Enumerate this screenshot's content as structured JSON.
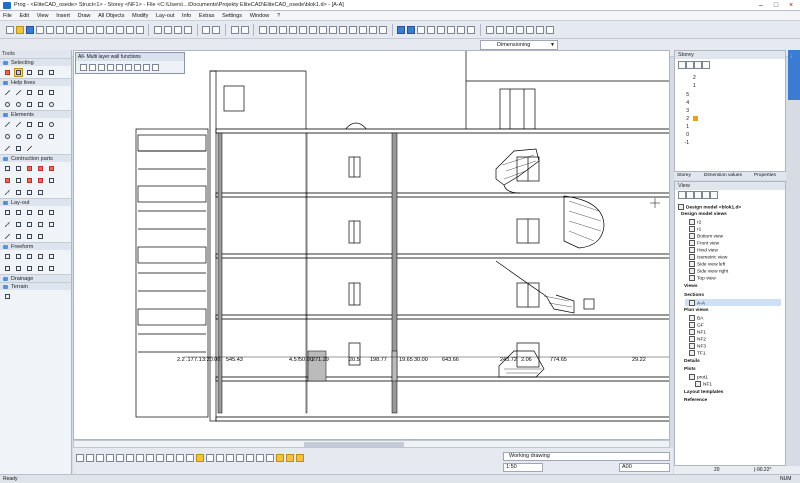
{
  "window": {
    "title": "Prog - <EliteCAD_osede> Struct<1> - Storey <NF1> - File <C:\\Users\\...\\Documents\\Projekty EliteCAD\\EliteCAD_osede\\blok1.d> - [A-A]",
    "min": "–",
    "max": "□",
    "close": "×"
  },
  "menu": [
    "File",
    "Edit",
    "View",
    "Insert",
    "Draw",
    "All Objects",
    "Modify",
    "Lay-out",
    "Info",
    "Extras",
    "Settings",
    "Window",
    "?"
  ],
  "dimension_select": "Dimensioning",
  "tools_panel": {
    "title": "Tools",
    "groups": [
      "Selecting",
      "Help lines",
      "Elements",
      "Contruction parts",
      "Lay-out",
      "Freeform",
      "Drainage",
      "Terrain"
    ]
  },
  "mlw_panel": {
    "title": "All- Multi layer wall functions"
  },
  "dimensions": [
    "2.2",
    ".17",
    "7.1",
    "3:20.00",
    "545.43",
    "4.57",
    "50.00",
    "271.29",
    "20.5",
    "198.77",
    "19.65",
    "30.00",
    "643.66",
    "243.72",
    "2.06",
    "774.65",
    "29.22"
  ],
  "storey_panel": {
    "title": "Storey",
    "numbers": [
      "-1",
      "0",
      "1",
      "2",
      "3",
      "4",
      "5"
    ],
    "labels": [
      "2",
      "1"
    ]
  },
  "right_tabs": [
    "Storey",
    "Dimension values",
    "Properties"
  ],
  "view_panel": {
    "title": "View",
    "design_model": "Design model <blok1.d>",
    "design_views_header": "Design model views",
    "design_views": [
      "r2",
      "r1",
      "Bottom view",
      "Front view",
      "Hind view",
      "Isometric view",
      "Side view left",
      "Side view right",
      "Top view"
    ],
    "views_header": "Views",
    "sections_header": "Sections",
    "sections": [
      "A-A"
    ],
    "plan_views_header": "Plan views",
    "plan_views": [
      "BA",
      "GF",
      "NF1",
      "NF2",
      "NF3",
      "TF1"
    ],
    "details_header": "Details",
    "plots_header": "Plots",
    "plots": [
      "prot1",
      "NF1"
    ],
    "layout_templates": "Layout templates",
    "reference": "Reference"
  },
  "bottom": {
    "working_drawing": "Working drawing",
    "scale": "1:50",
    "format": "A00",
    "coords": "|-90.22°",
    "status_ready": "Ready",
    "status_num": "NUM",
    "percent": "20"
  },
  "colors": {
    "accent": "#3b7bd1",
    "toolbar": "#e6eaf0",
    "panel": "#f0f3f7"
  }
}
